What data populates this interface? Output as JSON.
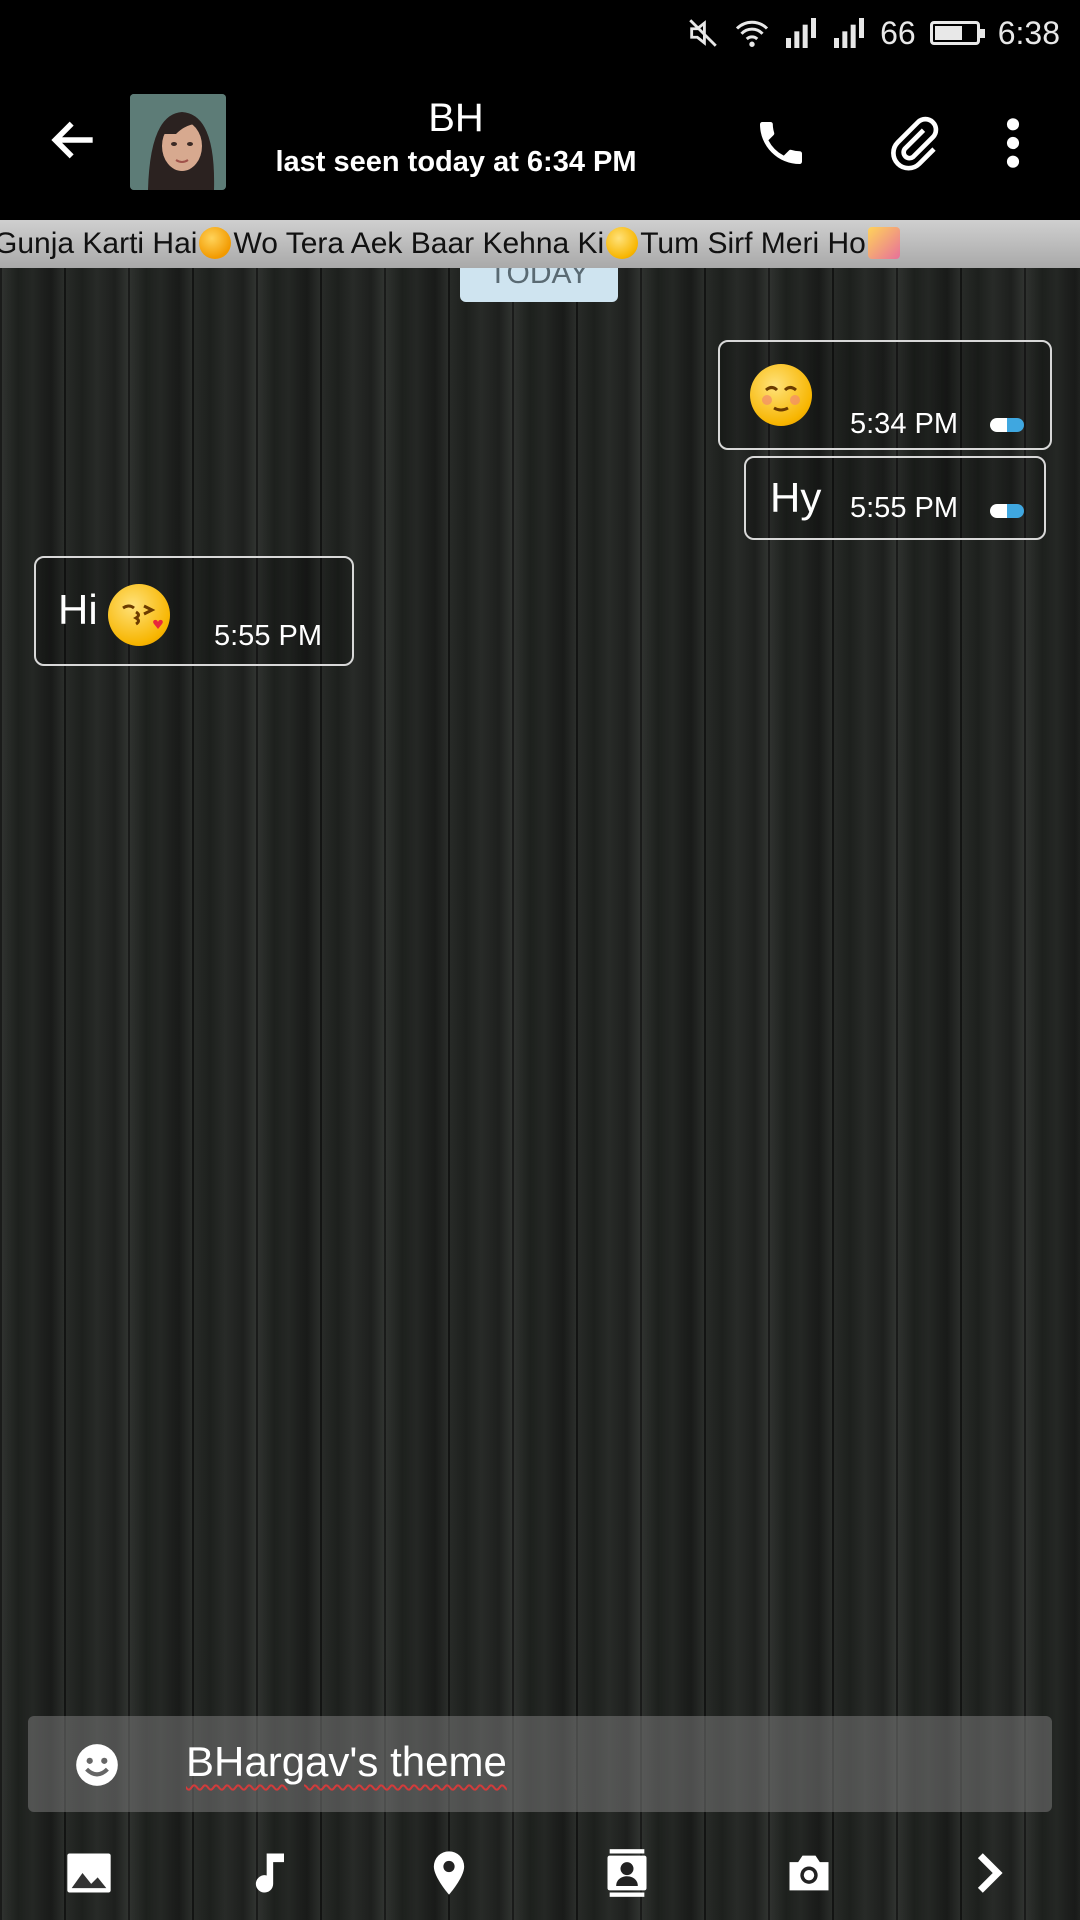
{
  "status_bar": {
    "battery_level": "66",
    "time": "6:38"
  },
  "header": {
    "contact_name": "BH",
    "last_seen": "last seen today at 6:34 PM"
  },
  "marquee": {
    "part1": "Gunja Karti Hai",
    "part2": "Wo Tera Aek Baar Kehna Ki",
    "part3": "Tum Sirf Meri Ho"
  },
  "date_divider": "TODAY",
  "messages": [
    {
      "direction": "outgoing",
      "text": "",
      "emoji": "relieved-face",
      "time": "5:34 PM"
    },
    {
      "direction": "outgoing",
      "text": "Hy",
      "time": "5:55 PM"
    },
    {
      "direction": "incoming",
      "text": "Hi",
      "emoji": "kissing-face",
      "time": "5:55 PM"
    }
  ],
  "compose": {
    "value": "BHargav's theme"
  },
  "colors": {
    "tick_blue": "#3fa7e0",
    "marquee_bg": "#bdbdbd",
    "today_pill": "#cfe4f0"
  }
}
